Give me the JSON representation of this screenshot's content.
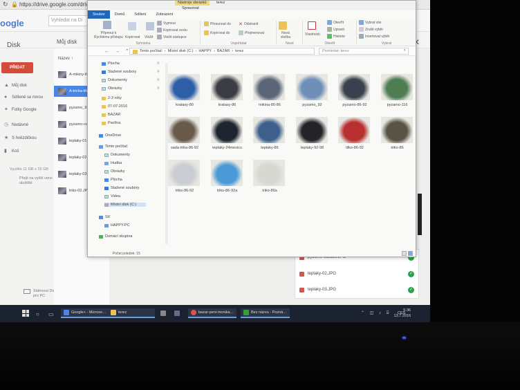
{
  "browser": {
    "url": "https://drive.google.com/drive"
  },
  "drive": {
    "logo": "oogle",
    "search_placeholder": "Vyhledat na Di",
    "title": "Disk",
    "crumb": "Můj disk",
    "new_button": "PŘIDAT",
    "nav": [
      {
        "label": "Můj disk",
        "icon": "drive-icon"
      },
      {
        "label": "Sdílené se mnou",
        "icon": "people-icon"
      },
      {
        "label": "Fotky Google",
        "icon": "photos-icon"
      },
      {
        "label": "Nedávné",
        "icon": "clock-icon"
      },
      {
        "label": "S hvězdičkou",
        "icon": "star-icon"
      },
      {
        "label": "Koš",
        "icon": "trash-icon"
      }
    ],
    "storage": "Využito 11 GB z 15 GB",
    "get_drive": "Přejít na vyšší verzi úložiště",
    "pc_promo": "Stáhnout Disk pro PC",
    "column_name": "Název ↑",
    "files": [
      "A-mikiny-fi…",
      "A-tricka-tilk…",
      "pyzamo_92…",
      "pyzamo-cc…",
      "teplaky-01.…",
      "teplaky-02.…",
      "teplaky-03.…",
      "triko-02.JP…"
    ],
    "uploads": [
      "pyzamo-cca110.JPG",
      "teplaky-02.JPG",
      "teplaky-03.JPG"
    ]
  },
  "explorer": {
    "tools_tab": "Nástroje obrázků",
    "tools_sub": "Spravovat",
    "window_title": "terez",
    "ribbon_tabs": [
      "Soubor",
      "Domů",
      "Sdílení",
      "Zobrazení"
    ],
    "ribbon": {
      "pin": "Připnout k Rychlému přístupu",
      "copy": "Kopírovat",
      "paste": "Vložit",
      "cut": "Vyjmout",
      "copy_path": "Kopírovat cestu",
      "paste_shortcut": "Vložit zástupce",
      "clipboard": "Schránka",
      "move_to": "Přesunout do",
      "copy_to": "Kopírovat do",
      "delete": "Odstranit",
      "rename": "Přejmenovat",
      "organize": "Uspořádat",
      "new_folder": "Nová složka",
      "new": "Nové",
      "properties": "Vlastnosti",
      "open": "Otevřít",
      "edit": "Upravit",
      "history": "Historie",
      "open_group": "Otevřít",
      "select_all": "Vybrat vše",
      "select_none": "Zrušit výběr",
      "invert": "Invertovat výběr",
      "select_group": "Vybrat"
    },
    "address": [
      "Tento počítač",
      "Místní disk (C:)",
      "HAPPY",
      "BAZAR",
      "terez"
    ],
    "search_placeholder": "Prohledat: terez",
    "nav": [
      {
        "label": "Plocha",
        "icon": "desktop-icon"
      },
      {
        "label": "Stažené soubory",
        "icon": "download-icon"
      },
      {
        "label": "Dokumenty",
        "icon": "documents-icon"
      },
      {
        "label": "Obrázky",
        "icon": "pictures-icon"
      },
      {
        "label": "2-3 roky",
        "icon": "folder-icon"
      },
      {
        "label": "07-07-2016",
        "icon": "folder-icon"
      },
      {
        "label": "BAZAR",
        "icon": "folder-icon"
      },
      {
        "label": "Pavlína",
        "icon": "folder-icon"
      },
      {
        "label": "OneDrive",
        "icon": "onedrive-icon"
      },
      {
        "label": "Tento počítač",
        "icon": "pc-icon"
      },
      {
        "label": "Dokumenty",
        "icon": "documents-icon"
      },
      {
        "label": "Hudba",
        "icon": "music-icon"
      },
      {
        "label": "Obrázky",
        "icon": "pictures-icon"
      },
      {
        "label": "Plocha",
        "icon": "desktop-icon"
      },
      {
        "label": "Stažené soubory",
        "icon": "download-icon"
      },
      {
        "label": "Videa",
        "icon": "video-icon"
      },
      {
        "label": "Místní disk (C:)",
        "icon": "disk-icon"
      },
      {
        "label": "Síť",
        "icon": "network-icon"
      },
      {
        "label": "HAPPY-PC",
        "icon": "pc-icon"
      },
      {
        "label": "Domácí skupina",
        "icon": "homegroup-icon"
      }
    ],
    "files": [
      {
        "name": "kratasy-80",
        "color": "#2d5fa8"
      },
      {
        "name": "kratasy-86",
        "color": "#3a3d44"
      },
      {
        "name": "mikina-80-86",
        "color": "#5a6578"
      },
      {
        "name": "pyzamo_92",
        "color": "#6e8fb8"
      },
      {
        "name": "pyzamo-86-92",
        "color": "#3c4150"
      },
      {
        "name": "pyzamo-116",
        "color": "#4f7d52"
      },
      {
        "name": "sada-trika-86-92",
        "color": "#6a5a4c"
      },
      {
        "name": "teplaky-24mesicu",
        "color": "#1e2430"
      },
      {
        "name": "teplaky-86",
        "color": "#3d5f8c"
      },
      {
        "name": "teplaky-92-98",
        "color": "#222428"
      },
      {
        "name": "tilko-86-92",
        "color": "#b83030"
      },
      {
        "name": "triko-86",
        "color": "#5a5244"
      },
      {
        "name": "triko-86-92",
        "color": "#c9cdd2"
      },
      {
        "name": "triko-86-92a",
        "color": "#4a9ad6"
      },
      {
        "name": "triko-86a",
        "color": "#d8d8d2"
      }
    ],
    "status": "Počet položek: 15"
  },
  "taskbar": {
    "items": [
      {
        "label": "Google+ - Microso…",
        "color": "#4a86e8"
      },
      {
        "label": "terez",
        "color": "#e8c35a"
      },
      {
        "label": "",
        "color": "#888888"
      },
      {
        "label": "bazar-peni-monika…",
        "color": "#d9534f"
      },
      {
        "label": "Bez názvu - Pozná…",
        "color": "#3a9c3a"
      }
    ],
    "lang": "CES",
    "time": "5:36",
    "date": "13.7.2016"
  }
}
